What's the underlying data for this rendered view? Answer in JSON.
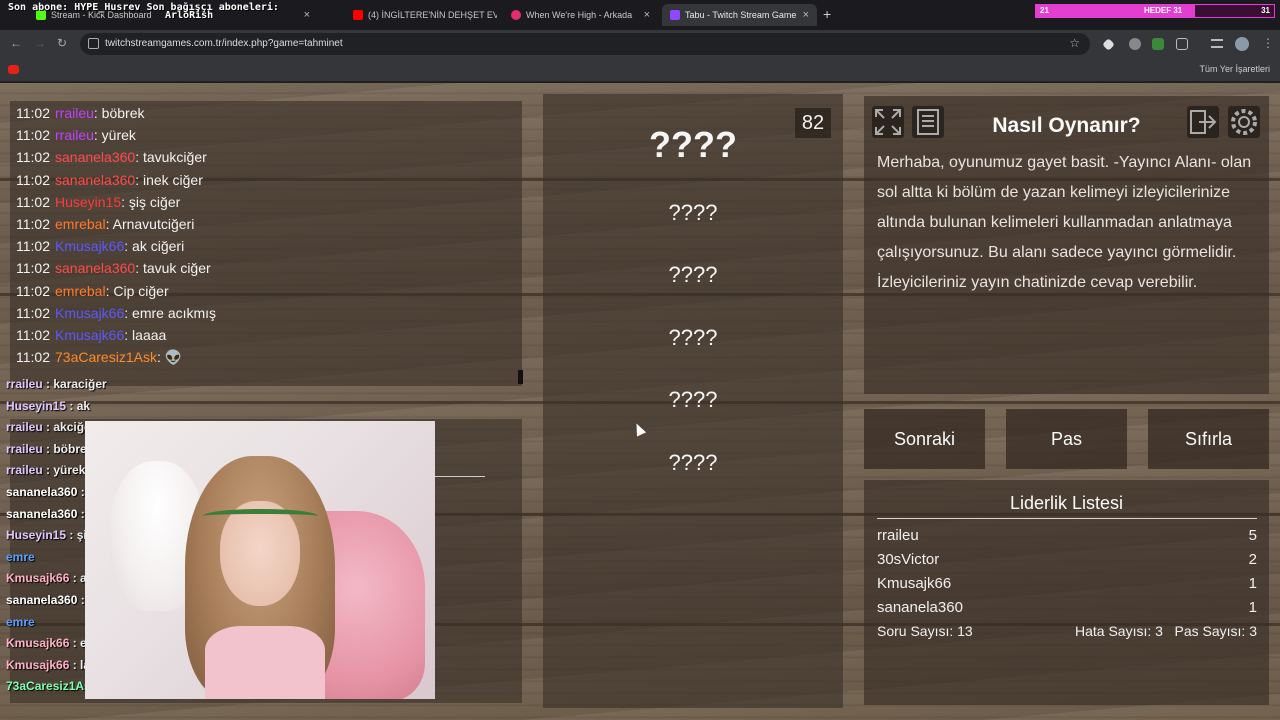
{
  "stream_overlay": {
    "ticker": "Son abone: HYPE_Husrev Son bağışçı aboneleri:",
    "ticker_name": "ArloRish",
    "goal_left": "21",
    "goal_label": "HEDEF 31",
    "goal_right": "31",
    "goal_progress": 0.67
  },
  "tabs": [
    {
      "label": "Stream - Kick Dashboard",
      "color": "#53fc18"
    },
    {
      "label": "(4) İNGİLTERE'NİN DEHŞET EVİ",
      "color": "#ff0000"
    },
    {
      "label": "When We're High - Arkada",
      "color": "#e52d6b"
    },
    {
      "label": "Tabu - Twitch Stream Game",
      "color": "#9146ff"
    }
  ],
  "browser": {
    "url": "twitchstreamgames.com.tr/index.php?game=tahminet",
    "bookmarks_all": "Tüm Yer İşaretleri"
  },
  "chat": [
    {
      "time": "11:02",
      "user": "rraileu",
      "color": "#c040ff",
      "msg": ": böbrek"
    },
    {
      "time": "11:02",
      "user": "rraileu",
      "color": "#c040ff",
      "msg": ": yürek"
    },
    {
      "time": "11:02",
      "user": "sananela360",
      "color": "#ff4a4a",
      "msg": ": tavukciğer"
    },
    {
      "time": "11:02",
      "user": "sananela360",
      "color": "#ff4a4a",
      "msg": ": inek ciğer"
    },
    {
      "time": "11:02",
      "user": "Huseyin15",
      "color": "#ff3a3a",
      "msg": ": şiş ciğer"
    },
    {
      "time": "11:02",
      "user": "emrebal",
      "color": "#ff7a2a",
      "msg": ": Arnavutciğeri"
    },
    {
      "time": "11:02",
      "user": "Kmusajk66",
      "color": "#5a5aff",
      "msg": ": ak ciğeri"
    },
    {
      "time": "11:02",
      "user": "sananela360",
      "color": "#ff4a4a",
      "msg": ": tavuk ciğer"
    },
    {
      "time": "11:02",
      "user": "emrebal",
      "color": "#ff7a2a",
      "msg": ": Cip ciğer"
    },
    {
      "time": "11:02",
      "user": "Kmusajk66",
      "color": "#5a5aff",
      "msg": ": emre acıkmış"
    },
    {
      "time": "11:02",
      "user": "Kmusajk66",
      "color": "#5a5aff",
      "msg": ": laaaa"
    },
    {
      "time": "11:02",
      "user": "73aCaresiz1Ask",
      "color": "#ff8a2a",
      "msg": ":"
    }
  ],
  "chat2": [
    {
      "user": "rraileu",
      "msg": " : karaciğer",
      "color": "#e0c8ff"
    },
    {
      "user": "Huseyin15",
      "msg": " : ak",
      "color": "#e0c8ff"
    },
    {
      "user": "rraileu",
      "msg": " : akciğe",
      "color": "#e0c8ff"
    },
    {
      "user": "rraileu",
      "msg": " : böbrel",
      "color": "#e0c8ff"
    },
    {
      "user": "rraileu",
      "msg": " : yürek",
      "color": "#e0c8ff"
    },
    {
      "user": "sananela360",
      "msg": " :",
      "color": "#ffffff"
    },
    {
      "user": "sananela360",
      "msg": " :",
      "color": "#ffffff"
    },
    {
      "user": "Huseyin15",
      "msg": " : şi",
      "color": "#e0c8ff"
    },
    {
      "user": "emre",
      "msg": "",
      "color": "#5aa0ff"
    },
    {
      "user": "Kmusajk66",
      "msg": " : a",
      "color": "#ffb0c8"
    },
    {
      "user": "sananela360",
      "msg": " :",
      "color": "#ffffff"
    },
    {
      "user": "emre",
      "msg": "",
      "color": "#5aa0ff"
    },
    {
      "user": "Kmusajk66",
      "msg": " : e",
      "color": "#ffb0c8"
    },
    {
      "user": "Kmusajk66",
      "msg": " : la",
      "color": "#ffb0c8"
    },
    {
      "user": "73aCaresiz1Ask",
      "msg": " :",
      "color": "#7fffb0"
    }
  ],
  "game": {
    "counter": "82",
    "main_word": "????",
    "forbidden_words": [
      "????",
      "????",
      "????",
      "????",
      "????"
    ]
  },
  "how_to": {
    "title": "Nasıl Oynanır?",
    "text": "Merhaba, oyunumuz gayet basit. -Yayıncı Alanı- olan sol altta ki bölüm de yazan kelimeyi izleyicilerinize altında bulunan kelimeleri kullanmadan anlatmaya çalışıyorsunuz. Bu alanı sadece yayıncı görmelidir. İzleyicileriniz yayın chatinizde cevap verebilir."
  },
  "buttons": {
    "next": "Sonraki",
    "pass": "Pas",
    "reset": "Sıfırla"
  },
  "leaderboard": {
    "title": "Liderlik Listesi",
    "rows": [
      {
        "name": "rraileu",
        "score": "5"
      },
      {
        "name": "30sVictor",
        "score": "2"
      },
      {
        "name": "Kmusajk66",
        "score": "1"
      },
      {
        "name": "sananela360",
        "score": "1"
      }
    ],
    "questions": "Soru Sayısı: 13",
    "errors": "Hata Sayısı: 3",
    "passes": "Pas Sayısı: 3"
  }
}
